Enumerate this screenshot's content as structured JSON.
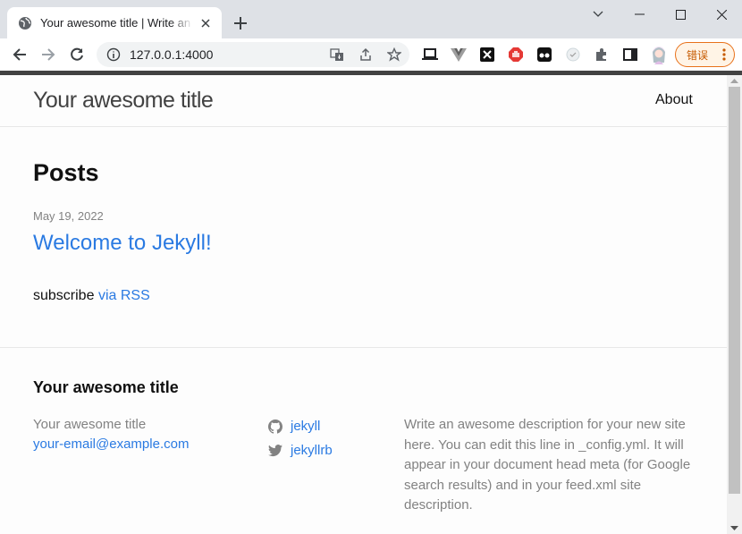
{
  "browser": {
    "tab_title": "Your awesome title | Write an awesome description for your new site",
    "url": "127.0.0.1:4000",
    "error_button_label": "错误",
    "icons": [
      "globe-icon",
      "close-icon",
      "plus-icon",
      "chevron-down-icon",
      "minimize-icon",
      "maximize-icon",
      "close-window-icon",
      "back-arrow-icon",
      "forward-arrow-icon",
      "reload-icon",
      "info-icon",
      "translate-icon",
      "share-icon",
      "star-icon",
      "laptop-icon",
      "vue-devtools-icon",
      "extension-x-icon",
      "adblock-icon",
      "tampermonkey-icon",
      "checked-extension-icon",
      "puzzle-icon",
      "side-panel-icon",
      "avatar",
      "more-vert-icon"
    ],
    "colors": {
      "tabstrip": "#dee1e6",
      "accent_link": "#2a7ae2",
      "error_accent": "#e8711a"
    }
  },
  "site": {
    "title": "Your awesome title",
    "nav": [
      {
        "label": "About"
      }
    ],
    "posts_heading": "Posts",
    "posts": [
      {
        "date": "May 19, 2022",
        "title": "Welcome to Jekyll!"
      }
    ],
    "subscribe_text": "subscribe",
    "subscribe_link": "via RSS"
  },
  "footer": {
    "heading": "Your awesome title",
    "name": "Your awesome title",
    "email": "your-email@example.com",
    "social": [
      {
        "icon": "github-icon",
        "label": "jekyll"
      },
      {
        "icon": "twitter-icon",
        "label": "jekyllrb"
      }
    ],
    "description": "Write an awesome description for your new site here. You can edit this line in _config.yml. It will appear in your document head meta (for Google search results) and in your feed.xml site description."
  }
}
